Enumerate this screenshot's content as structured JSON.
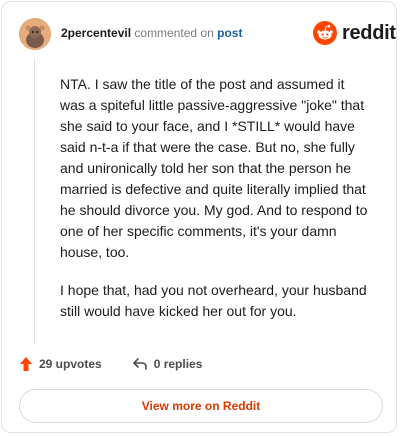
{
  "header": {
    "username": "2percentevil",
    "action": "commented on",
    "post_link": "post"
  },
  "brand": {
    "name": "reddit",
    "color": "#ff4500"
  },
  "comment": {
    "paragraphs": [
      "NTA. I saw the title of the post and assumed it was a spiteful little passive-aggressive \"joke\" that she said to your face, and I *STILL* would have said n-t-a if that were the case. But no, she fully and unironically told her son that the person he married is defective and quite literally implied that he should divorce you. My god. And to respond to one of her specific comments, it's your damn house, too.",
      "I hope that, had you not overheard, your husband still would have kicked her out for you."
    ]
  },
  "stats": {
    "upvotes": "29 upvotes",
    "replies": "0 replies"
  },
  "footer": {
    "view_more": "View more on Reddit"
  },
  "icons": {
    "upvote": "upvote-arrow-icon",
    "reply": "reply-arrow-icon",
    "logo": "reddit-snoo-icon",
    "avatar": "user-avatar"
  }
}
